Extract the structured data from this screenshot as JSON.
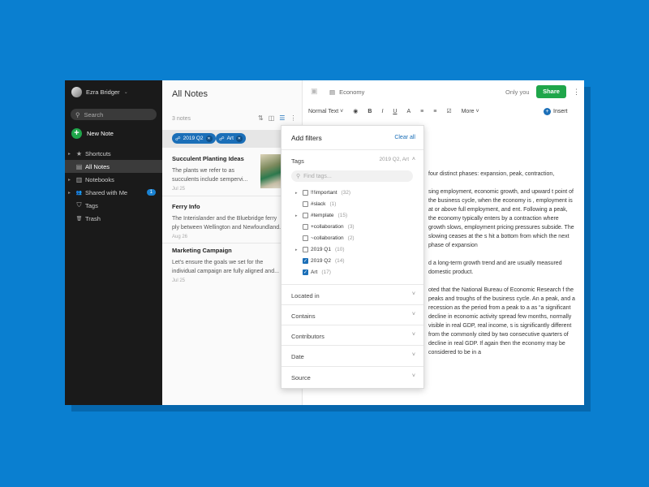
{
  "sidebar": {
    "user": "Ezra Bridger",
    "user_caret": "⌄",
    "search_placeholder": "Search",
    "new_note": "New Note",
    "items": [
      {
        "label": "Shortcuts",
        "icon": "star-icon",
        "glyph": "★",
        "caret": "▸"
      },
      {
        "label": "All Notes",
        "icon": "note-icon",
        "glyph": "▤",
        "caret": ""
      },
      {
        "label": "Notebooks",
        "icon": "notebook-icon",
        "glyph": "▥",
        "caret": "▸"
      },
      {
        "label": "Shared with Me",
        "icon": "people-icon",
        "glyph": "👥",
        "caret": "▸",
        "badge": "1"
      },
      {
        "label": "Tags",
        "icon": "tag-icon",
        "glyph": "⛉",
        "caret": ""
      },
      {
        "label": "Trash",
        "icon": "trash-icon",
        "glyph": "🗑",
        "caret": ""
      }
    ]
  },
  "notes": {
    "title": "All Notes",
    "count": "3 notes",
    "chips": [
      {
        "label": "2019 Q2"
      },
      {
        "label": "Art"
      }
    ],
    "items": [
      {
        "title": "Succulent Planting Ideas",
        "body": "The plants we refer to as succulents include sempervi...",
        "date": "Jul 25"
      },
      {
        "title": "Ferry Info",
        "body": "The Interislander and the Bluebridge ferry ply between Wellington and Newfoundland.",
        "date": "Aug 26"
      },
      {
        "title": "Marketing Campaign",
        "body": "Let's ensure the goals we set for the individual campaign are fully aligned and...",
        "date": "Jul 25"
      }
    ]
  },
  "editor": {
    "notebook": "Economy",
    "visibility": "Only you",
    "share": "Share",
    "toolbar": {
      "style": "Normal Text",
      "more": "More",
      "insert": "Insert"
    },
    "paragraphs": [
      "four distinct phases: expansion, peak, contraction,",
      "sing employment, economic growth, and upward t point of the business cycle, when the economy is , employment is at or above full employment, and ent. Following a peak, the economy typically enters by a contraction where growth slows, employment pricing pressures subside. The slowing ceases at the s hit a bottom from which the next phase of expansion",
      "d a long-term growth trend and are usually measured domestic product.",
      "oted that the National Bureau of Economic Research f the peaks and troughs of the business cycle. An a peak, and a recession as the period from a peak to a as “a significant decline in economic activity spread few months, normally visible in real GDP, real income, s is significantly different from the commonly cited by two consecutive quarters of decline in real GDP. If again then the economy may be considered to be in a"
    ]
  },
  "filters": {
    "title": "Add filters",
    "clear": "Clear all",
    "tags_label": "Tags",
    "tags_summary": "2019 Q2, Art",
    "tag_search_placeholder": "Find tags...",
    "tags": [
      {
        "name": "!!!important",
        "count": "(32)",
        "checked": false,
        "expand": true
      },
      {
        "name": "#slack",
        "count": "(1)",
        "checked": false,
        "expand": false
      },
      {
        "name": "#template",
        "count": "(15)",
        "checked": false,
        "expand": true
      },
      {
        "name": "+collaboration",
        "count": "(3)",
        "checked": false,
        "expand": false
      },
      {
        "name": "~collaboration",
        "count": "(2)",
        "checked": false,
        "expand": false
      },
      {
        "name": "2019 Q1",
        "count": "(10)",
        "checked": false,
        "expand": true
      },
      {
        "name": "2019 Q2",
        "count": "(14)",
        "checked": true,
        "expand": false
      },
      {
        "name": "Art",
        "count": "(17)",
        "checked": true,
        "expand": false
      }
    ],
    "sections": [
      "Located in",
      "Contains",
      "Contributors",
      "Date",
      "Source"
    ]
  },
  "colors": {
    "accent": "#1b6fb8",
    "share": "#1fa64a",
    "background": "#0a7fd0"
  }
}
